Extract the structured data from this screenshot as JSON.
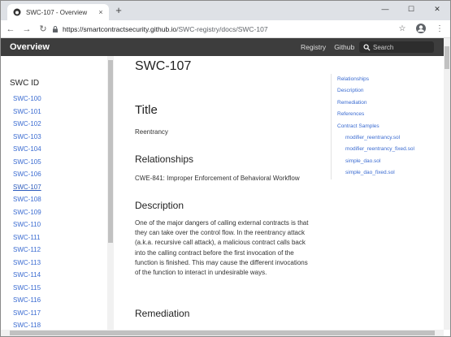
{
  "browser": {
    "tab_title": "SWC-107 - Overview",
    "tab_close": "×",
    "new_tab": "+",
    "url_host": "https://smartcontractsecurity.github.io",
    "url_path": "/SWC-registry/docs/SWC-107",
    "back_icon": "←",
    "forward_icon": "→",
    "reload_icon": "↻",
    "star_icon": "☆",
    "menu_icon": "⋮",
    "min_icon": "—",
    "max_icon": "☐",
    "close_icon": "✕"
  },
  "site": {
    "brand": "Overview",
    "nav": [
      "Registry",
      "Github"
    ],
    "search_placeholder": "Search"
  },
  "sidebar": {
    "title": "SWC ID",
    "active": "SWC-107",
    "items": [
      "SWC-100",
      "SWC-101",
      "SWC-102",
      "SWC-103",
      "SWC-104",
      "SWC-105",
      "SWC-106",
      "SWC-107",
      "SWC-108",
      "SWC-109",
      "SWC-110",
      "SWC-111",
      "SWC-112",
      "SWC-113",
      "SWC-114",
      "SWC-115",
      "SWC-116",
      "SWC-117",
      "SWC-118"
    ]
  },
  "main": {
    "page_title": "SWC-107",
    "title_heading": "Title",
    "title_text": "Reentrancy",
    "relationships_heading": "Relationships",
    "relationships_text": "CWE-841: Improper Enforcement of Behavioral Workflow",
    "description_heading": "Description",
    "description_text": "One of the major dangers of calling external contracts is that they can take over the control flow. In the reentrancy attack (a.k.a. recursive call attack), a malicious contract calls back into the calling contract before the first invocation of the function is finished. This may cause the different invocations of the function to interact in undesirable ways.",
    "remediation_heading": "Remediation"
  },
  "toc": {
    "items": [
      "Relationships",
      "Description",
      "Remediation",
      "References",
      "Contract Samples"
    ],
    "subitems": [
      "modifier_reentrancy.sol",
      "modifier_reentrancy_fixed.sol",
      "simple_dao.sol",
      "simple_dao_fixed.sol"
    ]
  },
  "colors": {
    "header_bg": "#3d3d3d",
    "link": "#3a6bd1",
    "tabbar": "#dee1e6"
  }
}
